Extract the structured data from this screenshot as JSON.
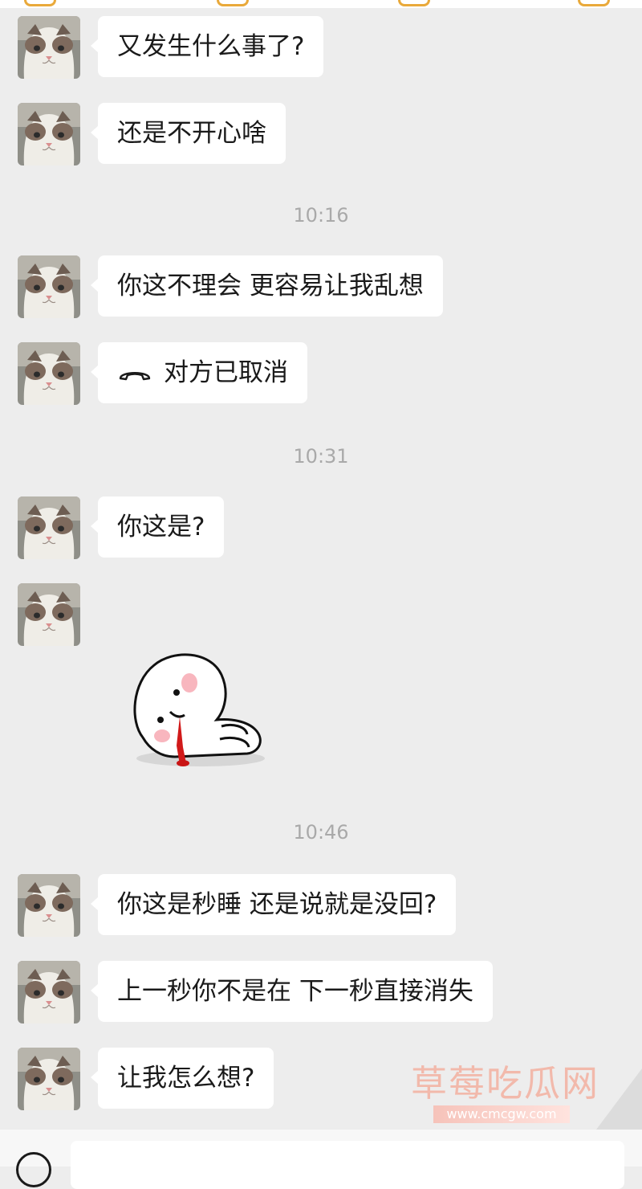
{
  "messages": [
    {
      "type": "text",
      "text": "又发生什么事了?"
    },
    {
      "type": "text",
      "text": "还是不开心啥"
    },
    {
      "type": "time",
      "text": "10:16"
    },
    {
      "type": "text",
      "text": "你这不理会 更容易让我乱想"
    },
    {
      "type": "call",
      "text": "对方已取消",
      "icon": "phone-hangup-icon"
    },
    {
      "type": "time",
      "text": "10:31"
    },
    {
      "type": "text",
      "text": "你这是?"
    },
    {
      "type": "sticker",
      "icon": "white-blob-bleeding-sticker"
    },
    {
      "type": "time",
      "text": "10:46"
    },
    {
      "type": "text",
      "text": "你这是秒睡 还是说就是没回?"
    },
    {
      "type": "text",
      "text": "上一秒你不是在 下一秒直接消失"
    },
    {
      "type": "text",
      "text": "让我怎么想?"
    }
  ],
  "watermark": {
    "title": "草莓吃瓜网",
    "url": "www.cmcgw.com"
  },
  "colors": {
    "background": "#ededed",
    "bubble": "#ffffff",
    "timestamp": "#a9a9a9",
    "watermark": "#f3b0a0"
  }
}
